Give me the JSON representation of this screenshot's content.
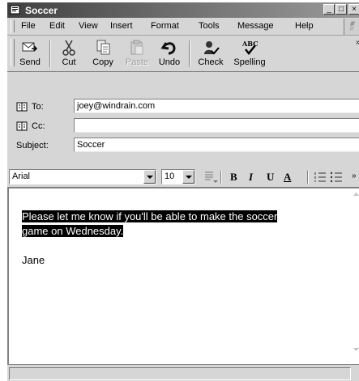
{
  "window": {
    "title": "Soccer"
  },
  "menu": [
    "File",
    "Edit",
    "View",
    "Insert",
    "Format",
    "Tools",
    "Message",
    "Help"
  ],
  "toolbar": {
    "send": "Send",
    "cut": "Cut",
    "copy": "Copy",
    "paste": "Paste",
    "undo": "Undo",
    "check": "Check",
    "spelling": "Spelling",
    "spelling_icon_text": "ABC"
  },
  "header": {
    "to_label": "To:",
    "to_value": "joey@windrain.com",
    "cc_label": "Cc:",
    "cc_value": "",
    "subject_label": "Subject:",
    "subject_value": "Soccer"
  },
  "format": {
    "font": "Arial",
    "size": "10",
    "bold": "B",
    "italic": "I",
    "underline": "U",
    "font_color": "A"
  },
  "message": {
    "line1": "Please let me know if you'll be able to make the soccer",
    "line2": "game on Wednesday.",
    "signature": "Jane"
  },
  "colors": {
    "selection": "#000000",
    "chrome": "#d6d6d6"
  }
}
